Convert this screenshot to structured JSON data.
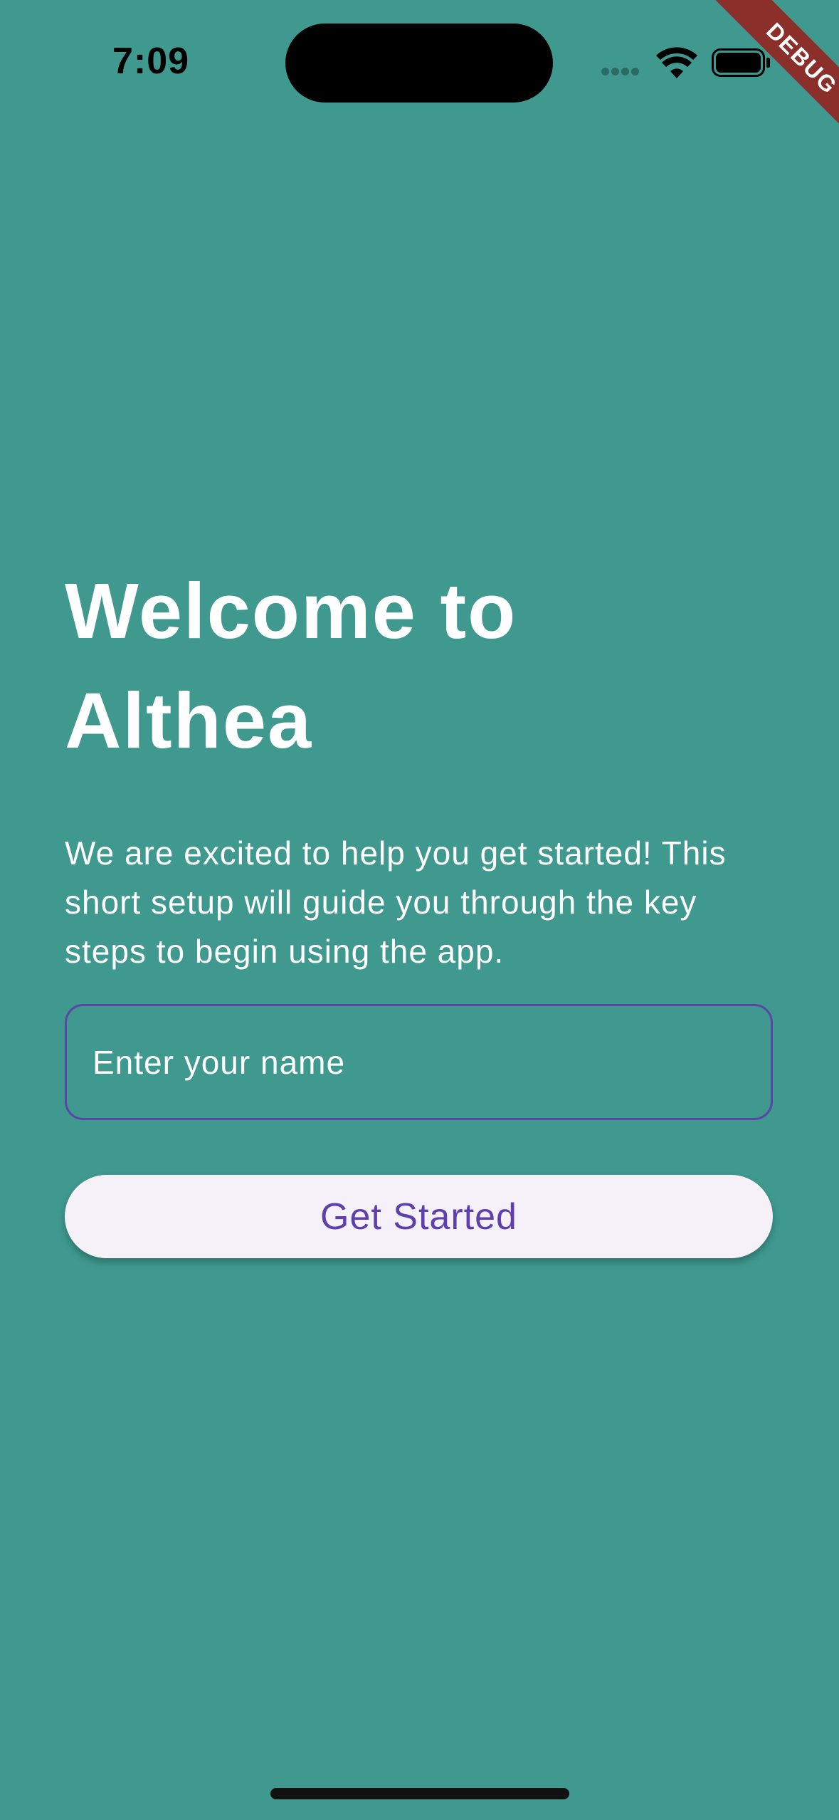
{
  "status_bar": {
    "time": "7:09"
  },
  "debug_banner": {
    "label": "DEBUG"
  },
  "welcome": {
    "title": "Welcome to Althea",
    "body": "We are excited to help you get started! This short setup will guide you through the key steps to begin using the app."
  },
  "name_input": {
    "value": "",
    "placeholder": "Enter your name"
  },
  "get_started": {
    "label": "Get Started"
  },
  "colors": {
    "background": "#3f998f",
    "accent": "#5e3fae",
    "button_background": "#f6f1f9",
    "debug_banner": "#8b2f2a"
  },
  "icons": {
    "signal": "signal-icon",
    "wifi": "wifi-icon",
    "battery": "battery-icon"
  }
}
